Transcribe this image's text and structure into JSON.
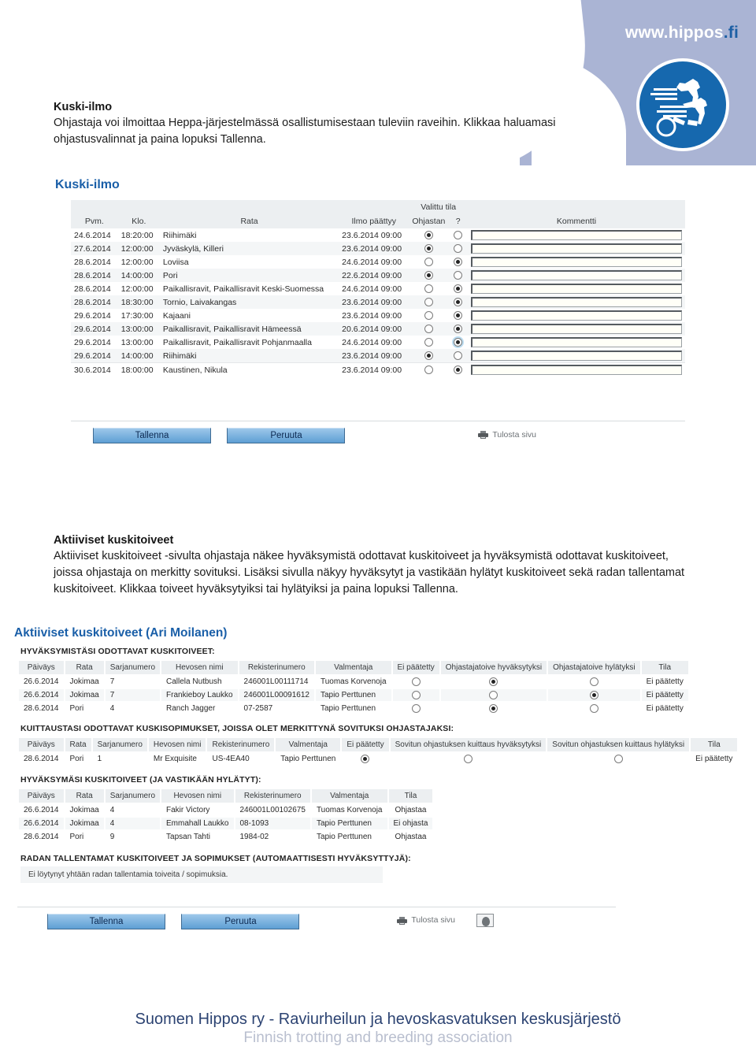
{
  "header": {
    "site_url_main": "www.hippos",
    "site_url_tld": ".fi",
    "logo_alt": "hippos-logo"
  },
  "intro1": {
    "heading": "Kuski-ilmo",
    "body": "Ohjastaja voi ilmoittaa Heppa-järjestelmässä osallistumisestaan tuleviin raveihin. Klikkaa haluamasi ohjastusvalinnat ja paina lopuksi Tallenna."
  },
  "intro2": {
    "heading": "Aktiiviset kuskitoiveet",
    "body": "Aktiiviset kuskitoiveet -sivulta ohjastaja näkee hyväksymistä odottavat kuskitoiveet ja hyväksymistä odottavat kuskitoiveet, joissa ohjastaja on merkitty sovituksi. Lisäksi sivulla näkyy hyväksytyt ja vastikään hylätyt kuskitoiveet sekä radan tallentamat kuskitoiveet. Klikkaa toiveet hyväksytyiksi tai hylätyiksi ja paina lopuksi Tallenna."
  },
  "panel1": {
    "title": "Kuski-ilmo",
    "group_header": "Valittu tila",
    "columns": {
      "date": "Pvm.",
      "time": "Klo.",
      "track": "Rata",
      "deadline": "Ilmo päättyy",
      "drive": "Ohjastan",
      "question": "?",
      "comment": "Kommentti"
    },
    "rows": [
      {
        "date": "24.6.2014",
        "time": "18:20:00",
        "track": "Riihimäki",
        "deadline": "23.6.2014 09:00",
        "drive": true,
        "question": false,
        "comment": ""
      },
      {
        "date": "27.6.2014",
        "time": "12:00:00",
        "track": "Jyväskylä, Killeri",
        "deadline": "23.6.2014 09:00",
        "drive": true,
        "question": false,
        "comment": ""
      },
      {
        "date": "28.6.2014",
        "time": "12:00:00",
        "track": "Loviisa",
        "deadline": "24.6.2014 09:00",
        "drive": false,
        "question": true,
        "comment": ""
      },
      {
        "date": "28.6.2014",
        "time": "14:00:00",
        "track": "Pori",
        "deadline": "22.6.2014 09:00",
        "drive": true,
        "question": false,
        "comment": ""
      },
      {
        "date": "28.6.2014",
        "time": "12:00:00",
        "track": "Paikallisravit, Paikallisravit Keski-Suomessa",
        "deadline": "24.6.2014 09:00",
        "drive": false,
        "question": true,
        "comment": ""
      },
      {
        "date": "28.6.2014",
        "time": "18:30:00",
        "track": "Tornio, Laivakangas",
        "deadline": "23.6.2014 09:00",
        "drive": false,
        "question": true,
        "comment": ""
      },
      {
        "date": "29.6.2014",
        "time": "17:30:00",
        "track": "Kajaani",
        "deadline": "23.6.2014 09:00",
        "drive": false,
        "question": true,
        "comment": ""
      },
      {
        "date": "29.6.2014",
        "time": "13:00:00",
        "track": "Paikallisravit, Paikallisravit Hämeessä",
        "deadline": "20.6.2014 09:00",
        "drive": false,
        "question": true,
        "comment": ""
      },
      {
        "date": "29.6.2014",
        "time": "13:00:00",
        "track": "Paikallisravit, Paikallisravit Pohjanmaalla",
        "deadline": "24.6.2014 09:00",
        "drive": false,
        "question": true,
        "comment": ""
      },
      {
        "date": "29.6.2014",
        "time": "14:00:00",
        "track": "Riihimäki",
        "deadline": "23.6.2014 09:00",
        "drive": true,
        "question": false,
        "comment": ""
      },
      {
        "date": "30.6.2014",
        "time": "18:00:00",
        "track": "Kaustinen, Nikula",
        "deadline": "23.6.2014 09:00",
        "drive": false,
        "question": true,
        "comment": ""
      }
    ],
    "actions": {
      "save": "Tallenna",
      "cancel": "Peruuta",
      "print": "Tulosta sivu"
    }
  },
  "panel2": {
    "title": "Aktiiviset kuskitoiveet (Ari Moilanen)",
    "section1": {
      "title": "HYVÄKSYMISTÄSI ODOTTAVAT KUSKITOIVEET:",
      "columns": [
        "Päiväys",
        "Rata",
        "Sarjanumero",
        "Hevosen nimi",
        "Rekisterinumero",
        "Valmentaja",
        "Ei päätetty",
        "Ohjastajatoive hyväksytyksi",
        "Ohjastajatoive hylätyksi",
        "Tila"
      ],
      "rows": [
        {
          "date": "26.6.2014",
          "track": "Jokimaa",
          "series": "7",
          "horse": "Callela Nutbush",
          "reg": "246001L00111714",
          "trainer": "Tuomas Korvenoja",
          "undecided": false,
          "accept": true,
          "reject": false,
          "status": "Ei päätetty"
        },
        {
          "date": "26.6.2014",
          "track": "Jokimaa",
          "series": "7",
          "horse": "Frankieboy Laukko",
          "reg": "246001L00091612",
          "trainer": "Tapio Perttunen",
          "undecided": false,
          "accept": false,
          "reject": true,
          "status": "Ei päätetty"
        },
        {
          "date": "28.6.2014",
          "track": "Pori",
          "series": "4",
          "horse": "Ranch Jagger",
          "reg": "07-2587",
          "trainer": "Tapio Perttunen",
          "undecided": false,
          "accept": true,
          "reject": false,
          "status": "Ei päätetty"
        }
      ]
    },
    "section2": {
      "title": "KUITTAUSTASI ODOTTAVAT KUSKISOPIMUKSET, JOISSA OLET MERKITTYNÄ SOVITUKSI OHJASTAJAKSI:",
      "columns": [
        "Päiväys",
        "Rata",
        "Sarjanumero",
        "Hevosen nimi",
        "Rekisterinumero",
        "Valmentaja",
        "Ei päätetty",
        "Sovitun ohjastuksen kuittaus hyväksytyksi",
        "Sovitun ohjastuksen kuittaus hylätyksi",
        "Tila"
      ],
      "rows": [
        {
          "date": "28.6.2014",
          "track": "Pori",
          "series": "1",
          "horse": "Mr Exquisite",
          "reg": "US-4EA40",
          "trainer": "Tapio Perttunen",
          "undecided": true,
          "accept": false,
          "reject": false,
          "status": "Ei päätetty"
        }
      ]
    },
    "section3": {
      "title": "HYVÄKSYMÄSI KUSKITOIVEET (JA VASTIKÄÄN HYLÄTYT):",
      "columns": [
        "Päiväys",
        "Rata",
        "Sarjanumero",
        "Hevosen nimi",
        "Rekisterinumero",
        "Valmentaja",
        "Tila"
      ],
      "rows": [
        {
          "date": "26.6.2014",
          "track": "Jokimaa",
          "series": "4",
          "horse": "Fakir Victory",
          "reg": "246001L00102675",
          "trainer": "Tuomas Korvenoja",
          "status": "Ohjastaa"
        },
        {
          "date": "26.6.2014",
          "track": "Jokimaa",
          "series": "4",
          "horse": "Emmahall Laukko",
          "reg": "08-1093",
          "trainer": "Tapio Perttunen",
          "status": "Ei ohjasta"
        },
        {
          "date": "28.6.2014",
          "track": "Pori",
          "series": "9",
          "horse": "Tapsan Tahti",
          "reg": "1984-02",
          "trainer": "Tapio Perttunen",
          "status": "Ohjastaa"
        }
      ]
    },
    "section4": {
      "title": "RADAN TALLENTAMAT KUSKITOIVEET JA SOPIMUKSET (AUTOMAATTISESTI HYVÄKSYTTYJÄ):",
      "empty_message": "Ei löytynyt yhtään radan tallentamia toiveita / sopimuksia."
    },
    "actions": {
      "save": "Tallenna",
      "cancel": "Peruuta",
      "print": "Tulosta sivu"
    }
  },
  "footer": {
    "line1": "Suomen Hippos ry - Raviurheilun ja hevoskasvatuksen keskusjärjestö",
    "line2": "Finnish trotting and breeding association"
  }
}
